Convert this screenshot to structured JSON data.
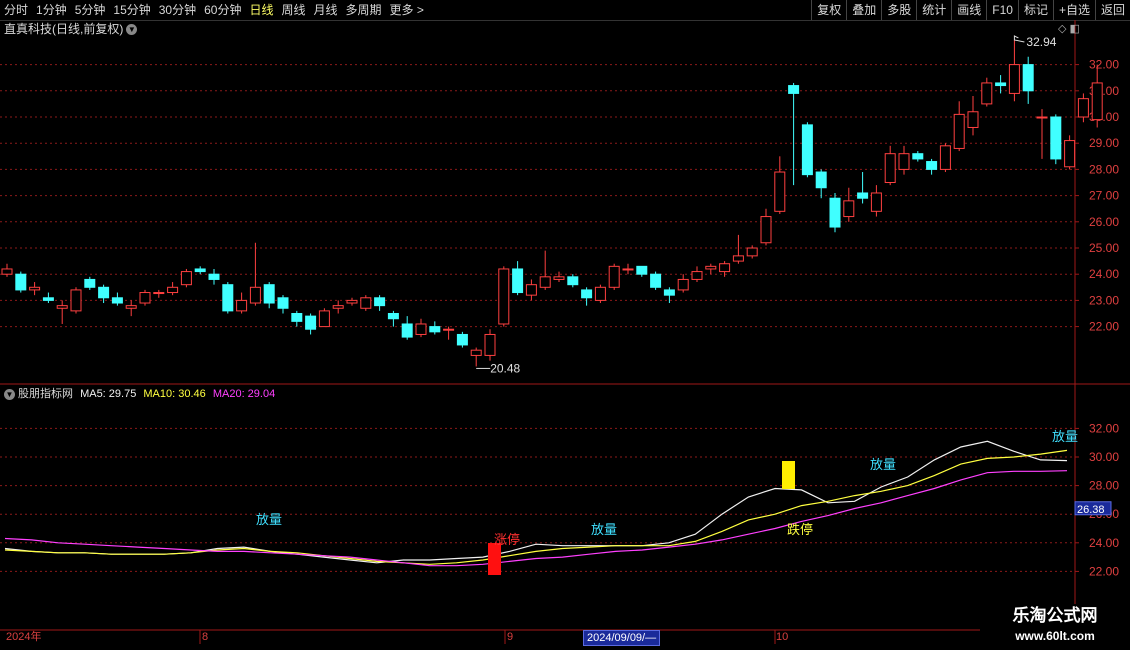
{
  "toolbar": {
    "periods": [
      "分时",
      "1分钟",
      "5分钟",
      "15分钟",
      "30分钟",
      "60分钟",
      "日线",
      "周线",
      "月线",
      "多周期",
      "更多"
    ],
    "active_period": "日线",
    "more_arrow": ">",
    "buttons": [
      "复权",
      "叠加",
      "多股",
      "统计",
      "画线",
      "F10",
      "标记",
      "+自选",
      "返回"
    ]
  },
  "stock": {
    "title": "直真科技(日线,前复权)",
    "high_label": "32.94",
    "low_label": "20.48"
  },
  "price_axis": {
    "ticks": [
      32.0,
      31.0,
      30.0,
      29.0,
      28.0,
      27.0,
      26.0,
      25.0,
      24.0,
      23.0,
      22.0
    ]
  },
  "indicator": {
    "name": "股朋指标网",
    "ma5_label": "MA5: 29.75",
    "ma10_label": "MA10: 30.46",
    "ma20_label": "MA20: 29.04",
    "current_value": "26.38",
    "ticks": [
      32.0,
      30.0,
      28.0,
      26.0,
      24.0,
      22.0
    ],
    "annotations": [
      {
        "text": "放量",
        "color": "#40e0ff"
      },
      {
        "text": "涨停",
        "color": "#ff3030"
      },
      {
        "text": "放量",
        "color": "#40e0ff"
      },
      {
        "text": "跌停",
        "color": "#ffff40"
      },
      {
        "text": "放量",
        "color": "#40e0ff"
      },
      {
        "text": "放量",
        "color": "#40e0ff"
      }
    ]
  },
  "date_axis": {
    "labels": [
      "2024年",
      "8",
      "9",
      "10"
    ],
    "cursor": "2024/09/09/—"
  },
  "watermark": {
    "line1": "乐淘公式网",
    "line2": "www.60lt.com"
  },
  "colors": {
    "up": "#ff4040",
    "down": "#40ffff",
    "grid": "#8b1a1a",
    "axis": "#a01818",
    "axis_text": "#e04040"
  },
  "chart_data": {
    "type": "candlestick",
    "candles": [
      [
        24.0,
        24.2,
        24.4,
        23.9
      ],
      [
        24.0,
        23.4,
        24.1,
        23.3
      ],
      [
        23.4,
        23.5,
        23.7,
        23.2
      ],
      [
        23.1,
        23.0,
        23.3,
        22.9
      ],
      [
        22.7,
        22.8,
        23.0,
        22.1
      ],
      [
        22.6,
        23.4,
        23.5,
        22.5
      ],
      [
        23.8,
        23.5,
        23.9,
        23.4
      ],
      [
        23.5,
        23.1,
        23.6,
        22.9
      ],
      [
        23.1,
        22.9,
        23.3,
        22.8
      ],
      [
        22.7,
        22.8,
        23.0,
        22.4
      ],
      [
        22.9,
        23.3,
        23.4,
        22.8
      ],
      [
        23.3,
        23.3,
        23.4,
        23.1
      ],
      [
        23.3,
        23.5,
        23.7,
        23.2
      ],
      [
        23.6,
        24.1,
        24.2,
        23.5
      ],
      [
        24.2,
        24.1,
        24.3,
        24.0
      ],
      [
        24.0,
        23.8,
        24.2,
        23.6
      ],
      [
        23.6,
        22.6,
        23.7,
        22.5
      ],
      [
        22.6,
        23.0,
        23.3,
        22.5
      ],
      [
        22.9,
        23.5,
        25.2,
        22.8
      ],
      [
        23.6,
        22.9,
        23.7,
        22.7
      ],
      [
        23.1,
        22.7,
        23.2,
        22.5
      ],
      [
        22.5,
        22.2,
        22.6,
        22.0
      ],
      [
        22.4,
        21.9,
        22.5,
        21.7
      ],
      [
        22.0,
        22.6,
        22.7,
        22.0
      ],
      [
        22.7,
        22.8,
        23.0,
        22.5
      ],
      [
        22.9,
        23.0,
        23.1,
        22.8
      ],
      [
        22.7,
        23.1,
        23.2,
        22.6
      ],
      [
        23.1,
        22.8,
        23.2,
        22.6
      ],
      [
        22.5,
        22.3,
        22.6,
        22.0
      ],
      [
        22.1,
        21.6,
        22.4,
        21.5
      ],
      [
        21.7,
        22.1,
        22.3,
        21.6
      ],
      [
        22.0,
        21.8,
        22.2,
        21.7
      ],
      [
        21.9,
        21.9,
        22.0,
        21.5
      ],
      [
        21.7,
        21.3,
        21.8,
        21.2
      ],
      [
        20.9,
        21.1,
        21.2,
        20.48
      ],
      [
        20.9,
        21.7,
        21.9,
        20.7
      ],
      [
        22.1,
        24.2,
        24.3,
        22.0
      ],
      [
        24.2,
        23.3,
        24.5,
        23.2
      ],
      [
        23.2,
        23.6,
        23.8,
        23.0
      ],
      [
        23.5,
        23.9,
        24.9,
        23.4
      ],
      [
        23.8,
        23.9,
        24.1,
        23.7
      ],
      [
        23.9,
        23.6,
        24.0,
        23.5
      ],
      [
        23.4,
        23.1,
        23.5,
        22.8
      ],
      [
        23.0,
        23.5,
        23.6,
        22.9
      ],
      [
        23.5,
        24.3,
        24.4,
        23.4
      ],
      [
        24.2,
        24.2,
        24.4,
        24.0
      ],
      [
        24.3,
        24.0,
        24.3,
        23.9
      ],
      [
        24.0,
        23.5,
        24.1,
        23.4
      ],
      [
        23.4,
        23.2,
        23.5,
        22.9
      ],
      [
        23.4,
        23.8,
        24.0,
        23.3
      ],
      [
        23.8,
        24.1,
        24.3,
        23.7
      ],
      [
        24.2,
        24.3,
        24.4,
        24.0
      ],
      [
        24.1,
        24.4,
        24.5,
        23.9
      ],
      [
        24.5,
        24.7,
        25.5,
        24.4
      ],
      [
        24.7,
        25.0,
        25.1,
        24.6
      ],
      [
        25.2,
        26.2,
        26.5,
        25.1
      ],
      [
        26.4,
        27.9,
        28.5,
        26.3
      ],
      [
        31.2,
        30.9,
        31.3,
        27.4
      ],
      [
        29.7,
        27.8,
        29.8,
        27.7
      ],
      [
        27.9,
        27.3,
        28.0,
        26.9
      ],
      [
        26.9,
        25.8,
        27.1,
        25.6
      ],
      [
        26.2,
        26.8,
        27.3,
        26.0
      ],
      [
        27.1,
        26.9,
        27.9,
        26.7
      ],
      [
        26.4,
        27.1,
        27.4,
        26.2
      ],
      [
        27.5,
        28.6,
        28.9,
        27.4
      ],
      [
        28.0,
        28.6,
        28.9,
        27.8
      ],
      [
        28.6,
        28.4,
        28.7,
        28.3
      ],
      [
        28.3,
        28.0,
        28.4,
        27.8
      ],
      [
        28.0,
        28.9,
        29.0,
        27.9
      ],
      [
        28.8,
        30.1,
        30.6,
        28.7
      ],
      [
        29.6,
        30.2,
        30.8,
        29.3
      ],
      [
        30.5,
        31.3,
        31.5,
        30.4
      ],
      [
        31.3,
        31.2,
        31.6,
        30.9
      ],
      [
        30.9,
        32.0,
        32.94,
        30.6
      ],
      [
        32.0,
        31.0,
        32.3,
        30.5
      ],
      [
        30.0,
        30.0,
        30.3,
        28.4
      ],
      [
        30.0,
        28.4,
        30.1,
        28.2
      ],
      [
        28.1,
        29.1,
        29.3,
        28.0
      ],
      [
        30.0,
        30.7,
        30.9,
        29.8
      ],
      [
        29.9,
        31.3,
        32.0,
        29.6
      ]
    ],
    "ma_series": [
      {
        "name": "MA5",
        "color": "#f0f0f0",
        "values": [
          23.6,
          23.4,
          23.3,
          23.3,
          23.2,
          23.2,
          23.2,
          23.3,
          23.6,
          23.7,
          23.4,
          23.2,
          23.0,
          22.8,
          22.6,
          22.8,
          22.8,
          22.9,
          23.0,
          23.4,
          23.9,
          23.8,
          23.8,
          23.8,
          23.8,
          24.0,
          24.6,
          26.0,
          27.2,
          27.8,
          27.7,
          26.8,
          26.9,
          27.9,
          28.6,
          29.8,
          30.7,
          31.1,
          30.4,
          29.8,
          29.75
        ]
      },
      {
        "name": "MA10",
        "color": "#ffff40",
        "values": [
          23.5,
          23.4,
          23.3,
          23.3,
          23.2,
          23.2,
          23.2,
          23.3,
          23.5,
          23.6,
          23.4,
          23.3,
          23.1,
          22.9,
          22.7,
          22.6,
          22.5,
          22.6,
          22.8,
          23.1,
          23.4,
          23.6,
          23.7,
          23.8,
          23.8,
          23.8,
          24.1,
          24.8,
          25.6,
          26.0,
          26.6,
          26.9,
          27.3,
          27.6,
          28.0,
          28.7,
          29.5,
          29.9,
          30.0,
          30.2,
          30.46
        ]
      },
      {
        "name": "MA20",
        "color": "#ff40ff",
        "values": [
          24.3,
          24.2,
          24.0,
          23.9,
          23.8,
          23.7,
          23.6,
          23.5,
          23.4,
          23.4,
          23.3,
          23.2,
          23.1,
          23.0,
          22.8,
          22.6,
          22.4,
          22.4,
          22.5,
          22.7,
          22.9,
          23.0,
          23.2,
          23.4,
          23.5,
          23.7,
          23.9,
          24.2,
          24.6,
          25.0,
          25.5,
          25.9,
          26.4,
          26.8,
          27.3,
          27.8,
          28.4,
          28.9,
          29.0,
          29.0,
          29.04
        ]
      }
    ]
  }
}
